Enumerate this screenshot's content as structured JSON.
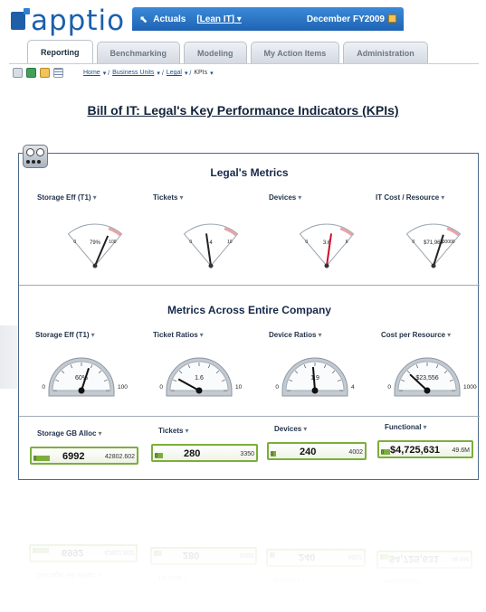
{
  "app": {
    "logo": "apptio",
    "context": {
      "scenario": "Actuals",
      "model": "[Lean IT]",
      "period": "December FY2009"
    }
  },
  "tabs": [
    {
      "label": "Reporting",
      "active": true
    },
    {
      "label": "Benchmarking",
      "active": false
    },
    {
      "label": "Modeling",
      "active": false
    },
    {
      "label": "My Action Items",
      "active": false
    },
    {
      "label": "Administration",
      "active": false
    }
  ],
  "toolbar": {
    "icons": [
      "print-icon",
      "excel-icon",
      "folder-icon",
      "grid-icon"
    ]
  },
  "breadcrumb": [
    {
      "label": "Home",
      "link": true
    },
    {
      "label": "Business Units",
      "link": true
    },
    {
      "label": "Legal",
      "link": true
    },
    {
      "label": "KPIs",
      "link": false
    }
  ],
  "page_title": "Bill of IT: Legal's Key Performance Indicators (KPIs)",
  "sections": {
    "legal_metrics": {
      "title": "Legal's Metrics",
      "gauges": [
        {
          "label": "Storage Eff (T1)",
          "min": "0",
          "max": "100",
          "value": "79%",
          "fraction": 0.79,
          "needle": "#222222"
        },
        {
          "label": "Tickets",
          "min": "0",
          "max": "10",
          "value": "4",
          "fraction": 0.4,
          "needle": "#222222"
        },
        {
          "label": "Devices",
          "min": "0",
          "max": "6",
          "value": "3.6",
          "fraction": 0.6,
          "needle": "#c8102e"
        },
        {
          "label": "IT Cost / Resource",
          "min": "0",
          "max": "100000",
          "value": "$71,964",
          "fraction": 0.72,
          "needle": "#222222"
        }
      ]
    },
    "company_metrics": {
      "title": "Metrics Across Entire Company",
      "gauges": [
        {
          "label": "Storage Eff (T1)",
          "min": "0",
          "max": "100",
          "value": "60%",
          "fraction": 0.6
        },
        {
          "label": "Ticket Ratios",
          "min": "0",
          "max": "10",
          "value": "1.6",
          "fraction": 0.16
        },
        {
          "label": "Device Ratios",
          "min": "0",
          "max": "4",
          "value": "1.9",
          "fraction": 0.475
        },
        {
          "label": "Cost per Resource",
          "min": "0",
          "max": "100000",
          "value": "$23,556",
          "fraction": 0.24
        }
      ]
    },
    "counters": [
      {
        "label": "Storage GB Alloc",
        "min": "0",
        "value": "6992",
        "max": "42802.602",
        "fraction": 0.16
      },
      {
        "label": "Tickets",
        "min": "0",
        "value": "280",
        "max": "3350",
        "fraction": 0.08
      },
      {
        "label": "Devices",
        "min": "0",
        "value": "240",
        "max": "4002",
        "fraction": 0.06
      },
      {
        "label": "Functional",
        "min": "0",
        "value": "$4,725,631",
        "max": "49.6M",
        "fraction": 0.1
      }
    ]
  },
  "colors": {
    "brand_blue": "#1b5fae",
    "counter_green": "#7cae3c",
    "panel_border": "#4e6a8b"
  }
}
